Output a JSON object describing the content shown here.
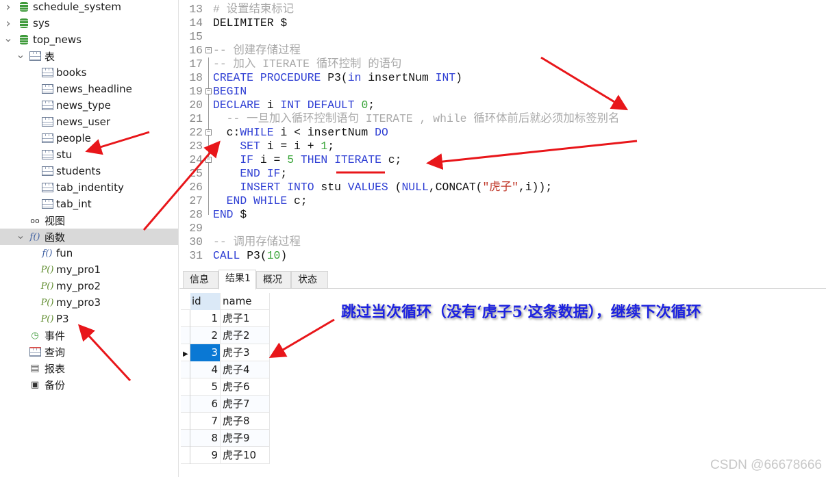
{
  "sidebar": {
    "items": [
      {
        "label": "schedule_system",
        "icon": "database-icon",
        "depth": 0,
        "chevron": "right"
      },
      {
        "label": "sys",
        "icon": "database-icon",
        "depth": 0,
        "chevron": "right"
      },
      {
        "label": "top_news",
        "icon": "database-icon",
        "depth": 0,
        "chevron": "down"
      },
      {
        "label": "表",
        "icon": "table-icon",
        "depth": 1,
        "chevron": "down"
      },
      {
        "label": "books",
        "icon": "table-icon",
        "depth": 2
      },
      {
        "label": "news_headline",
        "icon": "table-icon",
        "depth": 2
      },
      {
        "label": "news_type",
        "icon": "table-icon",
        "depth": 2
      },
      {
        "label": "news_user",
        "icon": "table-icon",
        "depth": 2
      },
      {
        "label": "people",
        "icon": "table-icon",
        "depth": 2
      },
      {
        "label": "stu",
        "icon": "table-icon",
        "depth": 2
      },
      {
        "label": "students",
        "icon": "table-icon",
        "depth": 2
      },
      {
        "label": "tab_indentity",
        "icon": "table-icon",
        "depth": 2
      },
      {
        "label": "tab_int",
        "icon": "table-icon",
        "depth": 2
      },
      {
        "label": "视图",
        "icon": "view-icon",
        "depth": 1
      },
      {
        "label": "函数",
        "icon": "function-icon",
        "depth": 1,
        "chevron": "down",
        "selected": true
      },
      {
        "label": "fun",
        "icon": "function-icon",
        "depth": 2
      },
      {
        "label": "my_pro1",
        "icon": "procedure-icon",
        "depth": 2
      },
      {
        "label": "my_pro2",
        "icon": "procedure-icon",
        "depth": 2
      },
      {
        "label": "my_pro3",
        "icon": "procedure-icon",
        "depth": 2
      },
      {
        "label": "P3",
        "icon": "procedure-icon",
        "depth": 2
      },
      {
        "label": "事件",
        "icon": "event-icon",
        "depth": 1
      },
      {
        "label": "查询",
        "icon": "query-icon",
        "depth": 1
      },
      {
        "label": "报表",
        "icon": "report-icon",
        "depth": 1
      },
      {
        "label": "备份",
        "icon": "backup-icon",
        "depth": 1
      }
    ]
  },
  "editor": {
    "lines": [
      {
        "n": "13",
        "seg": [
          [
            "cm",
            "# 设置结束标记"
          ]
        ]
      },
      {
        "n": "14",
        "seg": [
          [
            "tx",
            "DELIMITER $"
          ]
        ]
      },
      {
        "n": "15",
        "seg": []
      },
      {
        "n": "16",
        "fold": true,
        "seg": [
          [
            "cm",
            "-- 创建存储过程"
          ]
        ]
      },
      {
        "n": "17",
        "seg": [
          [
            "cm",
            "-- 加入 ITERATE 循环控制 的语句"
          ]
        ]
      },
      {
        "n": "18",
        "seg": [
          [
            "kw",
            "CREATE PROCEDURE "
          ],
          [
            "tx",
            "P3("
          ],
          [
            "kw",
            "in "
          ],
          [
            "tx",
            "insertNum "
          ],
          [
            "kw",
            "INT"
          ],
          [
            "tx",
            ")"
          ]
        ]
      },
      {
        "n": "19",
        "fold": true,
        "seg": [
          [
            "kw",
            "BEGIN"
          ]
        ]
      },
      {
        "n": "20",
        "seg": [
          [
            "kw",
            "DECLARE "
          ],
          [
            "tx",
            "i "
          ],
          [
            "kw",
            "INT DEFAULT "
          ],
          [
            "num",
            "0"
          ],
          [
            "tx",
            ";"
          ]
        ]
      },
      {
        "n": "21",
        "seg": [
          [
            "cm",
            "  -- 一旦加入循环控制语句 ITERATE , while 循环体前后就必须加标签别名"
          ]
        ]
      },
      {
        "n": "22",
        "fold": true,
        "seg": [
          [
            "tx",
            "  c:"
          ],
          [
            "kw",
            "WHILE "
          ],
          [
            "tx",
            "i < insertNum "
          ],
          [
            "kw",
            "DO"
          ]
        ]
      },
      {
        "n": "23",
        "seg": [
          [
            "kw",
            "    SET "
          ],
          [
            "tx",
            "i = i + "
          ],
          [
            "num",
            "1"
          ],
          [
            "tx",
            ";"
          ]
        ]
      },
      {
        "n": "24",
        "fold": true,
        "seg": [
          [
            "kw",
            "    IF "
          ],
          [
            "tx",
            "i = "
          ],
          [
            "num",
            "5"
          ],
          [
            "kw",
            " THEN ITERATE "
          ],
          [
            "tx",
            "c;"
          ]
        ]
      },
      {
        "n": "25",
        "seg": [
          [
            "kw",
            "    END IF"
          ],
          [
            "tx",
            ";"
          ]
        ]
      },
      {
        "n": "26",
        "seg": [
          [
            "kw",
            "    INSERT INTO "
          ],
          [
            "tx",
            "stu "
          ],
          [
            "kw",
            "VALUES "
          ],
          [
            "tx",
            "("
          ],
          [
            "kw",
            "NULL"
          ],
          [
            "tx",
            ",CONCAT("
          ],
          [
            "str",
            "\"虎子\""
          ],
          [
            "tx",
            ",i));"
          ]
        ]
      },
      {
        "n": "27",
        "seg": [
          [
            "kw",
            "  END WHILE "
          ],
          [
            "tx",
            "c;"
          ]
        ]
      },
      {
        "n": "28",
        "seg": [
          [
            "kw",
            "END "
          ],
          [
            "tx",
            "$"
          ]
        ]
      },
      {
        "n": "29",
        "seg": []
      },
      {
        "n": "30",
        "seg": [
          [
            "cm",
            "-- 调用存储过程"
          ]
        ]
      },
      {
        "n": "31",
        "seg": [
          [
            "kw",
            "CALL "
          ],
          [
            "tx",
            "P3("
          ],
          [
            "num",
            "10"
          ],
          [
            "tx",
            ")"
          ]
        ]
      }
    ]
  },
  "tabs": [
    {
      "label": "信息"
    },
    {
      "label": "结果1",
      "active": true
    },
    {
      "label": "概况"
    },
    {
      "label": "状态"
    }
  ],
  "grid": {
    "columns": [
      "id",
      "name"
    ],
    "rows": [
      [
        "1",
        "虎子1"
      ],
      [
        "2",
        "虎子2"
      ],
      [
        "3",
        "虎子3"
      ],
      [
        "4",
        "虎子4"
      ],
      [
        "5",
        "虎子6"
      ],
      [
        "6",
        "虎子7"
      ],
      [
        "7",
        "虎子8"
      ],
      [
        "8",
        "虎子9"
      ],
      [
        "9",
        "虎子10"
      ]
    ],
    "selected_row": 2
  },
  "annotation": "跳过当次循环（没有‘虎子5’这条数据），继续下次循环",
  "watermark": "CSDN @66678666",
  "colors": {
    "keyword": "#2f3fd4",
    "comment": "#a9a9a9",
    "number": "#3aa53a",
    "string": "#c0392b",
    "selection": "#0a78d4",
    "arrow": "#e8161a",
    "annotation": "#1d22e0"
  }
}
